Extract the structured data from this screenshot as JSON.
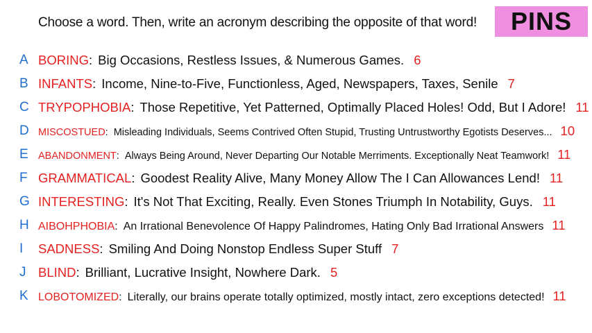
{
  "header": {
    "prompt": "Choose a word. Then, write an acronym describing the opposite of that word!",
    "badge": "PINS",
    "badge_color": "#f08fe0"
  },
  "colors": {
    "letter": "#1e6fd0",
    "word": "#e52121",
    "text": "#111111"
  },
  "entries": [
    {
      "letter": "A",
      "word": "BORING",
      "acronym": "Big Occasions, Restless Issues, & Numerous Games.",
      "count": "6"
    },
    {
      "letter": "B",
      "word": "INFANTS",
      "acronym": "Income, Nine-to-Five, Functionless, Aged, Newspapers, Taxes, Senile",
      "count": "7"
    },
    {
      "letter": "C",
      "word": "TRYPOPHOBIA",
      "acronym": "Those Repetitive, Yet Patterned, Optimally Placed Holes! Odd, But I Adore!",
      "count": "11"
    },
    {
      "letter": "D",
      "word": "MISCOSTUED",
      "acronym": "Misleading Individuals, Seems Contrived Often Stupid, Trusting Untrustworthy Egotists Deserves...",
      "count": "10"
    },
    {
      "letter": "E",
      "word": "ABANDONMENT",
      "acronym": "Always Being Around, Never Departing Our Notable Merriments. Exceptionally Neat Teamwork!",
      "count": "11"
    },
    {
      "letter": "F",
      "word": "GRAMMATICAL",
      "acronym": "Goodest Reality Alive, Many Money Allow The I Can Allowances Lend!",
      "count": "11"
    },
    {
      "letter": "G",
      "word": "INTERESTING",
      "acronym": "It's Not That Exciting, Really. Even Stones Triumph In Notability, Guys.",
      "count": "11"
    },
    {
      "letter": "H",
      "word": "AIBOHPHOBIA",
      "acronym": "An Irrational Benevolence Of Happy Palindromes, Hating Only Bad Irrational Answers",
      "count": "11"
    },
    {
      "letter": "I",
      "word": "SADNESS",
      "acronym": "Smiling And Doing Nonstop Endless Super Stuff",
      "count": "7"
    },
    {
      "letter": "J",
      "word": "BLIND",
      "acronym": "Brilliant, Lucrative Insight, Nowhere Dark.",
      "count": "5"
    },
    {
      "letter": "K",
      "word": "LOBOTOMIZED",
      "acronym": "Literally, our brains operate totally optimized, mostly intact, zero exceptions detected!",
      "count": "11"
    }
  ]
}
